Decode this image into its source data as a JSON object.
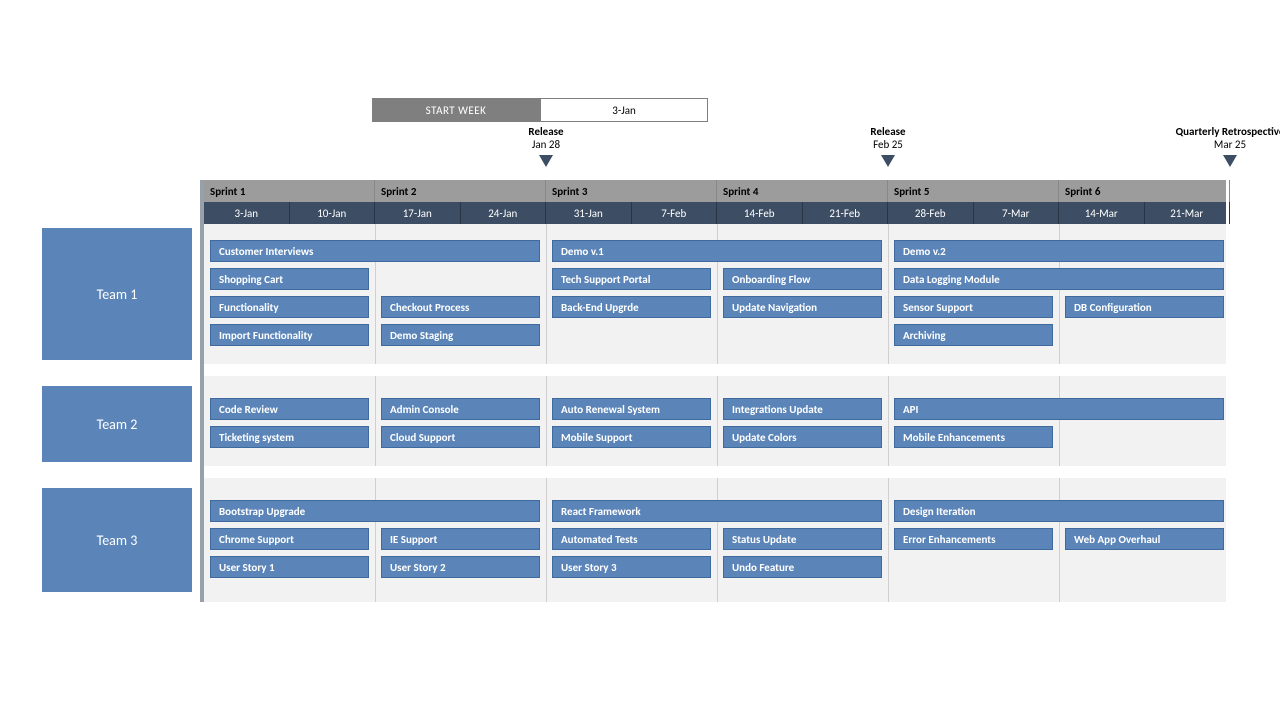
{
  "startWeek": {
    "label": "START WEEK",
    "value": "3-Jan"
  },
  "sprints": [
    "Sprint 1",
    "Sprint 2",
    "Sprint 3",
    "Sprint 4",
    "Sprint 5",
    "Sprint 6"
  ],
  "weeks": [
    "3-Jan",
    "10-Jan",
    "17-Jan",
    "24-Jan",
    "31-Jan",
    "7-Feb",
    "14-Feb",
    "21-Feb",
    "28-Feb",
    "7-Mar",
    "14-Mar",
    "21-Mar"
  ],
  "milestones": [
    {
      "title": "Release",
      "date": "Jan 28",
      "weekIndex": 4
    },
    {
      "title": "Release",
      "date": "Feb 25",
      "weekIndex": 8
    },
    {
      "title": "Quarterly Retrospective",
      "date": "Mar 25",
      "weekIndex": 12
    }
  ],
  "teams": [
    {
      "name": "Team 1",
      "rows": [
        [
          {
            "label": "Customer Interviews",
            "start": 0,
            "span": 4
          },
          {
            "label": "Demo v.1",
            "start": 4,
            "span": 4
          },
          {
            "label": "Demo v.2",
            "start": 8,
            "span": 4
          }
        ],
        [
          {
            "label": "Shopping Cart",
            "start": 0,
            "span": 2
          },
          {
            "label": "Tech Support Portal",
            "start": 4,
            "span": 2
          },
          {
            "label": "Onboarding Flow",
            "start": 6,
            "span": 2
          },
          {
            "label": "Data Logging Module",
            "start": 8,
            "span": 4
          }
        ],
        [
          {
            "label": "Functionality",
            "start": 0,
            "span": 2
          },
          {
            "label": "Checkout Process",
            "start": 2,
            "span": 2
          },
          {
            "label": "Back-End Upgrde",
            "start": 4,
            "span": 2
          },
          {
            "label": "Update Navigation",
            "start": 6,
            "span": 2
          },
          {
            "label": "Sensor Support",
            "start": 8,
            "span": 2
          },
          {
            "label": "DB Configuration",
            "start": 10,
            "span": 2
          }
        ],
        [
          {
            "label": "Import Functionality",
            "start": 0,
            "span": 2
          },
          {
            "label": "Demo Staging",
            "start": 2,
            "span": 2
          },
          {
            "label": "Archiving",
            "start": 8,
            "span": 2
          }
        ]
      ]
    },
    {
      "name": "Team 2",
      "rows": [
        [
          {
            "label": "Code Review",
            "start": 0,
            "span": 2
          },
          {
            "label": "Admin Console",
            "start": 2,
            "span": 2
          },
          {
            "label": "Auto Renewal System",
            "start": 4,
            "span": 2
          },
          {
            "label": "Integrations Update",
            "start": 6,
            "span": 2
          },
          {
            "label": "API",
            "start": 8,
            "span": 4
          }
        ],
        [
          {
            "label": "Ticketing system",
            "start": 0,
            "span": 2
          },
          {
            "label": "Cloud Support",
            "start": 2,
            "span": 2
          },
          {
            "label": "Mobile Support",
            "start": 4,
            "span": 2
          },
          {
            "label": "Update Colors",
            "start": 6,
            "span": 2
          },
          {
            "label": "Mobile Enhancements",
            "start": 8,
            "span": 2
          }
        ]
      ]
    },
    {
      "name": "Team 3",
      "rows": [
        [
          {
            "label": "Bootstrap Upgrade",
            "start": 0,
            "span": 4
          },
          {
            "label": "React Framework",
            "start": 4,
            "span": 4
          },
          {
            "label": "Design Iteration",
            "start": 8,
            "span": 4
          }
        ],
        [
          {
            "label": "Chrome Support",
            "start": 0,
            "span": 2
          },
          {
            "label": "IE Support",
            "start": 2,
            "span": 2
          },
          {
            "label": "Automated Tests",
            "start": 4,
            "span": 2
          },
          {
            "label": "Status Update",
            "start": 6,
            "span": 2
          },
          {
            "label": "Error Enhancements",
            "start": 8,
            "span": 2
          },
          {
            "label": "Web App Overhaul",
            "start": 10,
            "span": 2
          }
        ],
        [
          {
            "label": "User Story 1",
            "start": 0,
            "span": 2
          },
          {
            "label": "User Story 2",
            "start": 2,
            "span": 2
          },
          {
            "label": "User Story 3",
            "start": 4,
            "span": 2
          },
          {
            "label": "Undo Feature",
            "start": 6,
            "span": 2
          }
        ]
      ]
    }
  ],
  "chart_data": {
    "type": "table",
    "note": "Agile sprint roadmap / gantt. Columns are week start dates (12 weeks, 2 weeks per sprint). Each task spans the given number of weeks starting at weekIndex.",
    "weeks": [
      "3-Jan",
      "10-Jan",
      "17-Jan",
      "24-Jan",
      "31-Jan",
      "7-Feb",
      "14-Feb",
      "21-Feb",
      "28-Feb",
      "7-Mar",
      "14-Mar",
      "21-Mar"
    ],
    "sprints": {
      "Sprint 1": [
        0,
        1
      ],
      "Sprint 2": [
        2,
        3
      ],
      "Sprint 3": [
        4,
        5
      ],
      "Sprint 4": [
        6,
        7
      ],
      "Sprint 5": [
        8,
        9
      ],
      "Sprint 6": [
        10,
        11
      ]
    },
    "milestones": [
      {
        "label": "Release",
        "date": "Jan 28",
        "atWeekBoundary": 4
      },
      {
        "label": "Release",
        "date": "Feb 25",
        "atWeekBoundary": 8
      },
      {
        "label": "Quarterly Retrospective",
        "date": "Mar 25",
        "atWeekBoundary": 12
      }
    ],
    "teams": {
      "Team 1": [
        {
          "task": "Customer Interviews",
          "startWeek": 0,
          "weeks": 4
        },
        {
          "task": "Demo v.1",
          "startWeek": 4,
          "weeks": 4
        },
        {
          "task": "Demo v.2",
          "startWeek": 8,
          "weeks": 4
        },
        {
          "task": "Shopping Cart",
          "startWeek": 0,
          "weeks": 2
        },
        {
          "task": "Tech Support Portal",
          "startWeek": 4,
          "weeks": 2
        },
        {
          "task": "Onboarding Flow",
          "startWeek": 6,
          "weeks": 2
        },
        {
          "task": "Data Logging Module",
          "startWeek": 8,
          "weeks": 4
        },
        {
          "task": "Functionality",
          "startWeek": 0,
          "weeks": 2
        },
        {
          "task": "Checkout Process",
          "startWeek": 2,
          "weeks": 2
        },
        {
          "task": "Back-End Upgrde",
          "startWeek": 4,
          "weeks": 2
        },
        {
          "task": "Update Navigation",
          "startWeek": 6,
          "weeks": 2
        },
        {
          "task": "Sensor Support",
          "startWeek": 8,
          "weeks": 2
        },
        {
          "task": "DB Configuration",
          "startWeek": 10,
          "weeks": 2
        },
        {
          "task": "Import Functionality",
          "startWeek": 0,
          "weeks": 2
        },
        {
          "task": "Demo Staging",
          "startWeek": 2,
          "weeks": 2
        },
        {
          "task": "Archiving",
          "startWeek": 8,
          "weeks": 2
        }
      ],
      "Team 2": [
        {
          "task": "Code Review",
          "startWeek": 0,
          "weeks": 2
        },
        {
          "task": "Admin Console",
          "startWeek": 2,
          "weeks": 2
        },
        {
          "task": "Auto Renewal System",
          "startWeek": 4,
          "weeks": 2
        },
        {
          "task": "Integrations Update",
          "startWeek": 6,
          "weeks": 2
        },
        {
          "task": "API",
          "startWeek": 8,
          "weeks": 4
        },
        {
          "task": "Ticketing system",
          "startWeek": 0,
          "weeks": 2
        },
        {
          "task": "Cloud Support",
          "startWeek": 2,
          "weeks": 2
        },
        {
          "task": "Mobile Support",
          "startWeek": 4,
          "weeks": 2
        },
        {
          "task": "Update Colors",
          "startWeek": 6,
          "weeks": 2
        },
        {
          "task": "Mobile Enhancements",
          "startWeek": 8,
          "weeks": 2
        }
      ],
      "Team 3": [
        {
          "task": "Bootstrap Upgrade",
          "startWeek": 0,
          "weeks": 4
        },
        {
          "task": "React Framework",
          "startWeek": 4,
          "weeks": 4
        },
        {
          "task": "Design Iteration",
          "startWeek": 8,
          "weeks": 4
        },
        {
          "task": "Chrome Support",
          "startWeek": 0,
          "weeks": 2
        },
        {
          "task": "IE Support",
          "startWeek": 2,
          "weeks": 2
        },
        {
          "task": "Automated Tests",
          "startWeek": 4,
          "weeks": 2
        },
        {
          "task": "Status Update",
          "startWeek": 6,
          "weeks": 2
        },
        {
          "task": "Error Enhancements",
          "startWeek": 8,
          "weeks": 2
        },
        {
          "task": "Web App Overhaul",
          "startWeek": 10,
          "weeks": 2
        },
        {
          "task": "User Story 1",
          "startWeek": 0,
          "weeks": 2
        },
        {
          "task": "User Story 2",
          "startWeek": 2,
          "weeks": 2
        },
        {
          "task": "User Story 3",
          "startWeek": 4,
          "weeks": 2
        },
        {
          "task": "Undo Feature",
          "startWeek": 6,
          "weeks": 2
        }
      ]
    }
  }
}
